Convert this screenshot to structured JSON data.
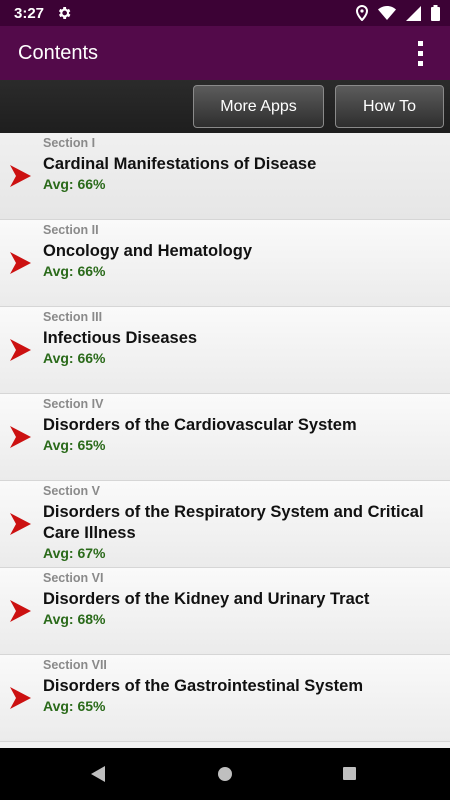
{
  "status_bar": {
    "time": "3:27",
    "icons": [
      "gear-icon",
      "location-icon",
      "wifi-icon",
      "signal-icon",
      "battery-icon"
    ]
  },
  "app_bar": {
    "title": "Contents",
    "menu_icon": "overflow-menu-icon",
    "color": "#530a4a"
  },
  "toolbar": {
    "more_apps_label": "More Apps",
    "how_to_label": "How To"
  },
  "sections": [
    {
      "section": "Section I",
      "title": "Cardinal Manifestations of Disease",
      "avg": "Avg: 66%"
    },
    {
      "section": "Section II",
      "title": "Oncology and Hematology",
      "avg": "Avg: 66%"
    },
    {
      "section": "Section III",
      "title": "Infectious Diseases",
      "avg": "Avg: 66%"
    },
    {
      "section": "Section IV",
      "title": "Disorders of the Cardiovascular System",
      "avg": "Avg: 65%"
    },
    {
      "section": "Section V",
      "title": "Disorders of the Respiratory System and Critical Care Illness",
      "avg": "Avg: 67%"
    },
    {
      "section": "Section VI",
      "title": "Disorders of the Kidney and Urinary Tract",
      "avg": "Avg: 68%"
    },
    {
      "section": "Section VII",
      "title": "Disorders of the Gastrointestinal System",
      "avg": "Avg: 65%"
    }
  ],
  "colors": {
    "avg_text": "#2a6a1a",
    "arrow": "#cc1111"
  },
  "nav_bar": {
    "icons": [
      "back-icon",
      "home-icon",
      "recents-icon"
    ]
  }
}
